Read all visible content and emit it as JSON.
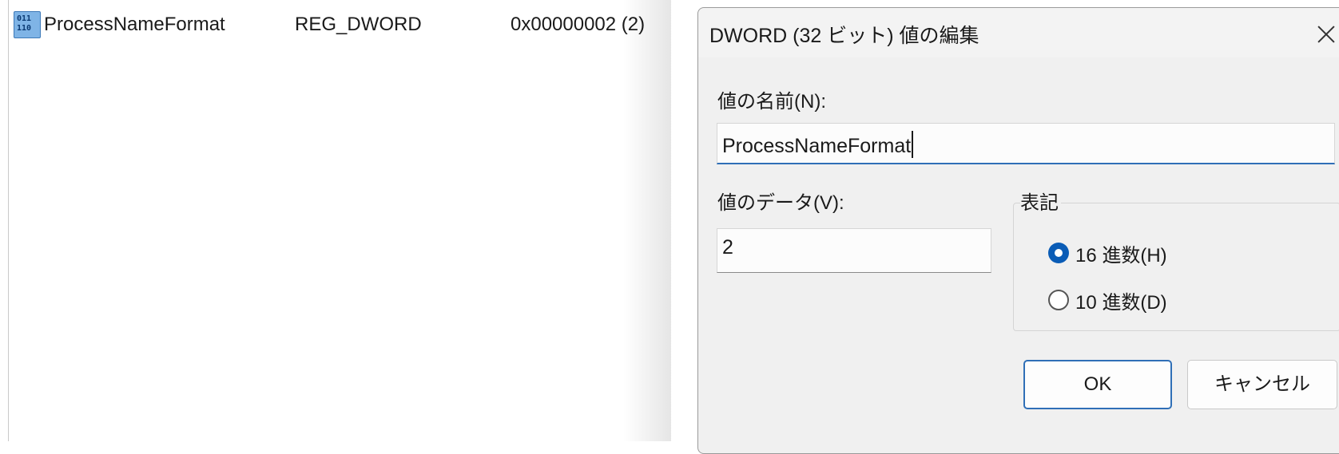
{
  "registry_list": {
    "row": {
      "name": "ProcessNameFormat",
      "type": "REG_DWORD",
      "data": "0x00000002 (2)",
      "icon": "dword-value-icon"
    }
  },
  "dialog": {
    "title": "DWORD (32 ビット) 値の編集",
    "close_icon": "close-icon",
    "value_name_label": "値の名前(N):",
    "value_name": "ProcessNameFormat",
    "value_data_label": "値のデータ(V):",
    "value_data": "2",
    "base_group_label": "表記",
    "base_options": [
      {
        "label": "16 進数(H)",
        "checked": true
      },
      {
        "label": "10 進数(D)",
        "checked": false
      }
    ],
    "ok_label": "OK",
    "cancel_label": "キャンセル"
  },
  "colors": {
    "accent": "#0a5cb6",
    "dialog_bg": "#f0f0f0",
    "window_bg": "#ffffff"
  }
}
